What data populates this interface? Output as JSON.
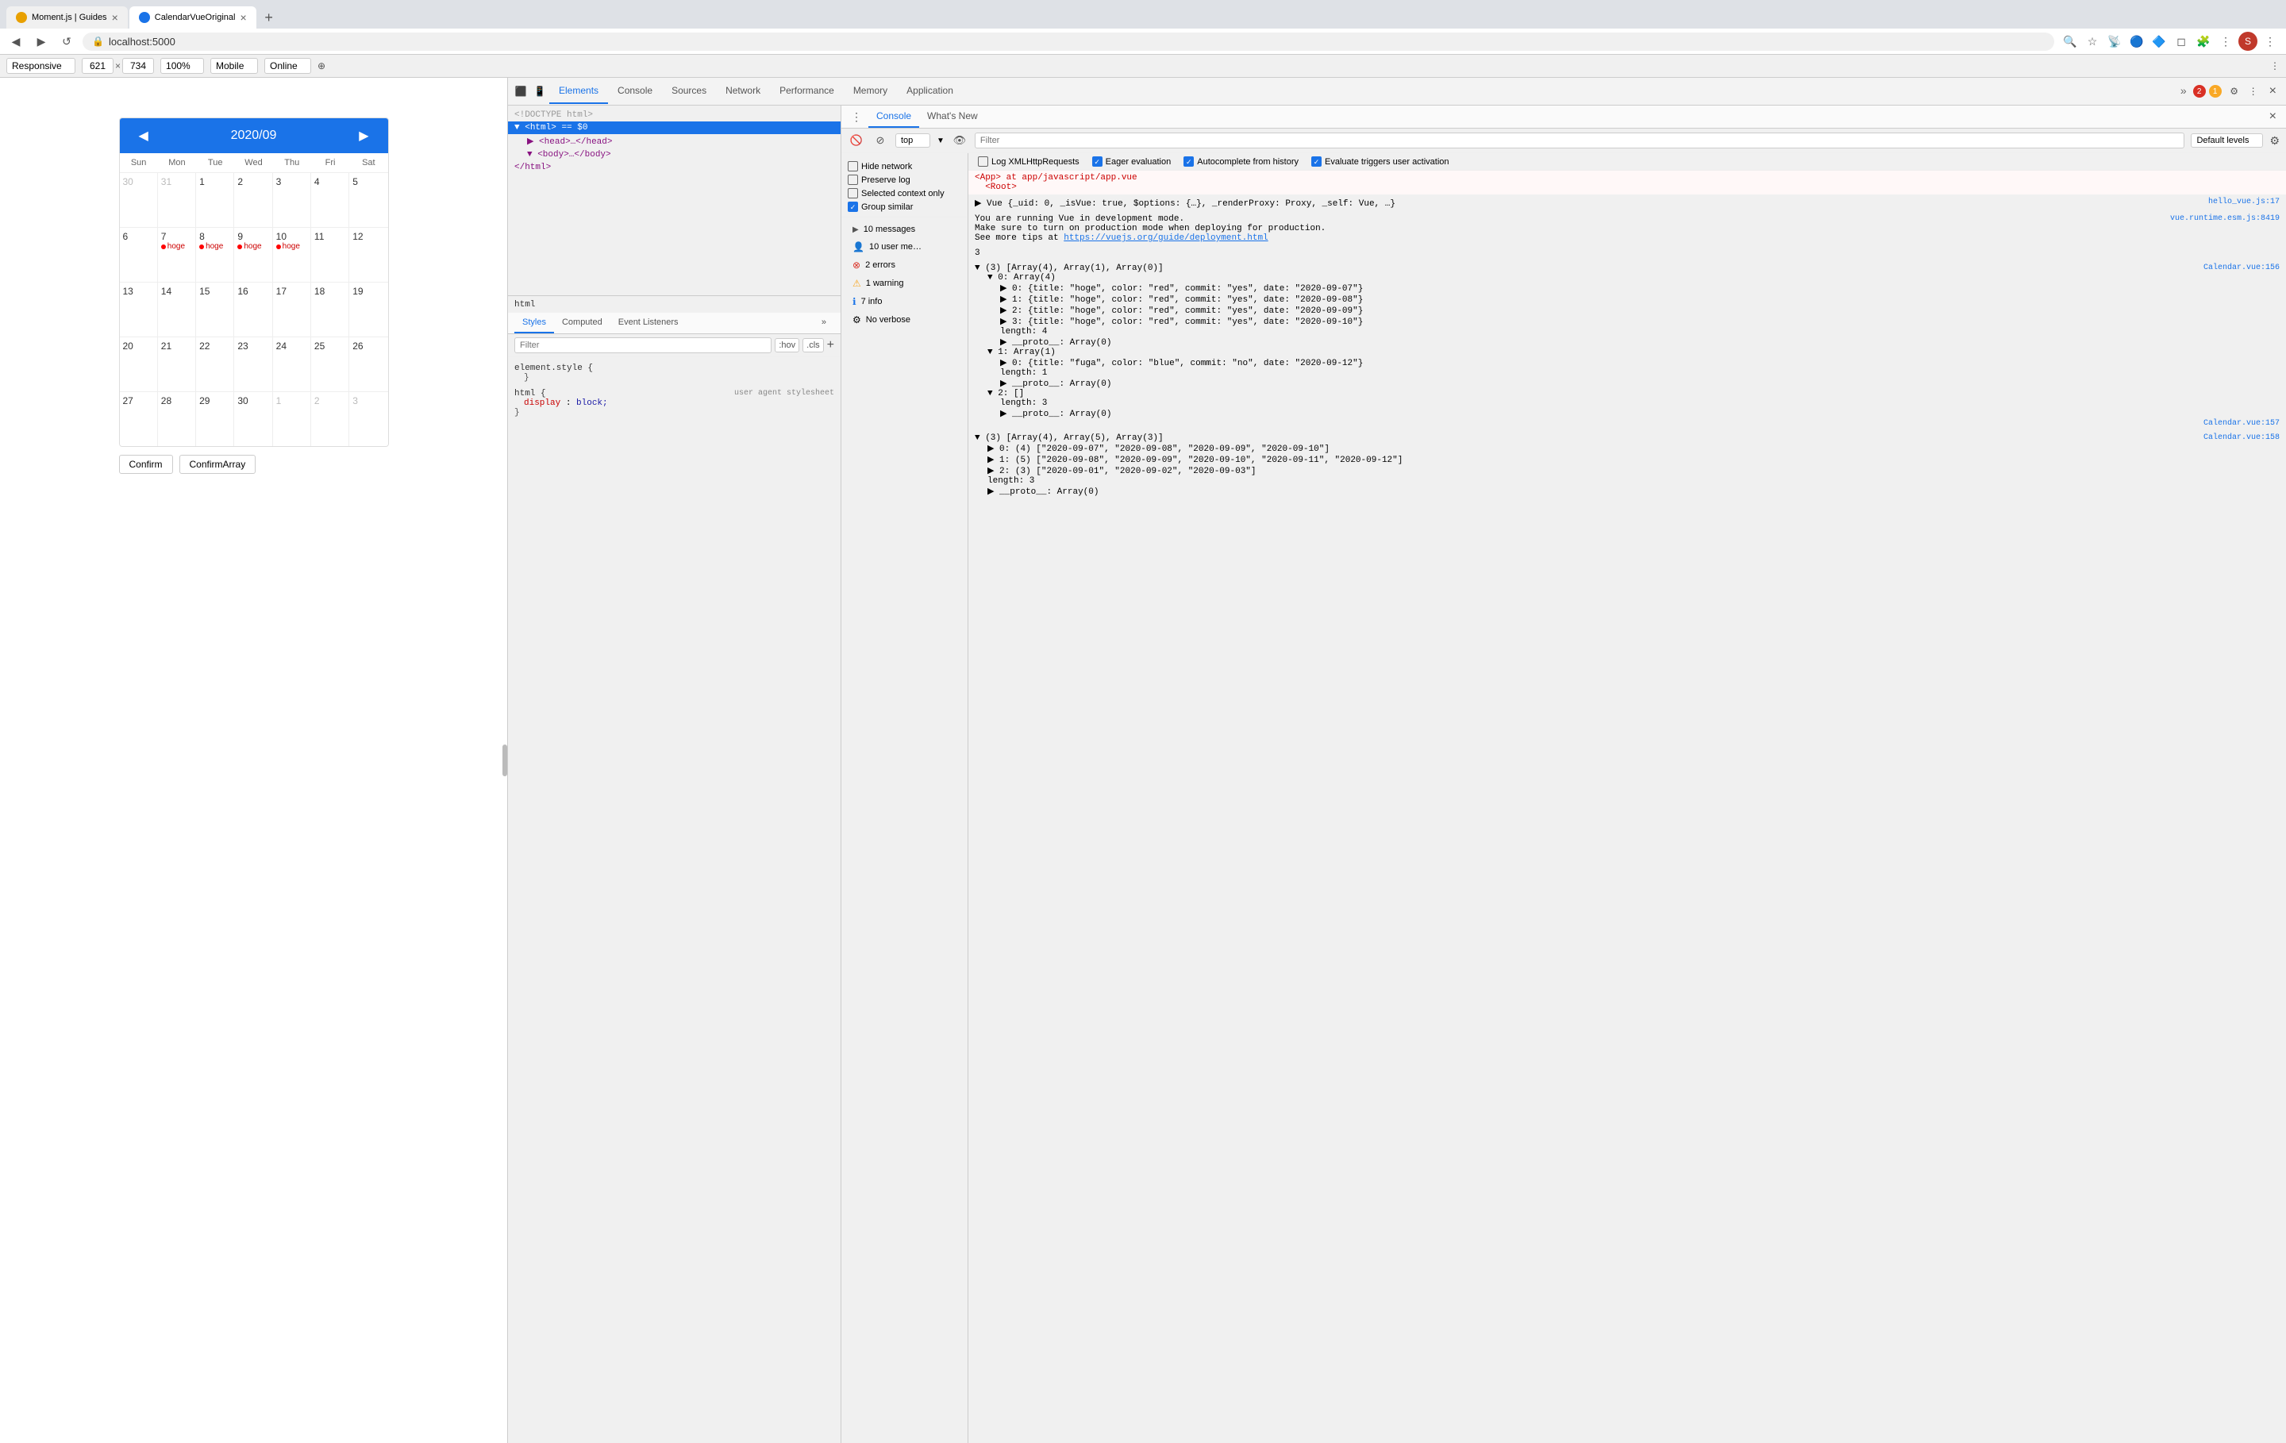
{
  "browser": {
    "tabs": [
      {
        "id": "tab1",
        "title": "Moment.js | Guides",
        "favicon_color": "#e8a000",
        "active": false
      },
      {
        "id": "tab2",
        "title": "CalendarVueOriginal",
        "favicon_color": "#1a73e8",
        "active": true
      }
    ],
    "new_tab_label": "+",
    "url": "localhost:5000",
    "nav": {
      "back_label": "◀",
      "forward_label": "▶",
      "reload_label": "↺"
    }
  },
  "devtools_bar": {
    "responsive_label": "Responsive",
    "width": "621",
    "height": "734",
    "zoom": "100%",
    "device": "Mobile",
    "throttle": "Online"
  },
  "devtools": {
    "tabs": [
      "Elements",
      "Console",
      "Sources",
      "Network",
      "Performance",
      "Memory",
      "Application"
    ],
    "active_tab": "Elements",
    "icons": [
      "device-toolbar",
      "inspect"
    ],
    "settings_label": "⚙",
    "close_label": "×",
    "more_label": "»"
  },
  "elements": {
    "lines": [
      {
        "text": "<!DOCTYPE html>",
        "indent": 0
      },
      {
        "text": "▼ <html> == $0",
        "indent": 0,
        "selected": true
      },
      {
        "text": "▶ <head>…</head>",
        "indent": 1
      },
      {
        "text": "▼ <body>…</body>",
        "indent": 1
      },
      {
        "text": "</html>",
        "indent": 0
      }
    ],
    "footer": "html"
  },
  "styles": {
    "sub_tabs": [
      "Styles",
      "Computed",
      "Event Listeners"
    ],
    "active_sub_tab": "Styles",
    "filter_placeholder": "Filter",
    "hov_label": ":hov",
    "cls_label": ".cls",
    "plus_label": "+",
    "rules": [
      {
        "selector": "element.style {",
        "props": [],
        "closing": "}",
        "source": ""
      },
      {
        "selector": "html {",
        "props": [
          {
            "name": "display",
            "value": "block;"
          }
        ],
        "closing": "}",
        "source": "user agent stylesheet"
      }
    ]
  },
  "console": {
    "tabs": [
      "Console",
      "What's New"
    ],
    "active_tab": "Console",
    "toolbar": {
      "ban_label": "🚫",
      "top_value": "top",
      "eye_label": "👁",
      "filter_placeholder": "Filter",
      "default_levels": "Default levels",
      "gear_label": "⚙"
    },
    "sidebar_items": [
      {
        "icon": "▶",
        "label": "10 messages",
        "count": "10",
        "active": false
      },
      {
        "icon": "👤",
        "label": "10 user me…",
        "count": "10",
        "active": false
      },
      {
        "icon": "🔴",
        "label": "2 errors",
        "count": "2",
        "active": false
      },
      {
        "icon": "⚠",
        "label": "1 warning",
        "count": "1",
        "active": false
      },
      {
        "icon": "ℹ",
        "label": "7 info",
        "count": "7",
        "active": false
      },
      {
        "icon": "⚙",
        "label": "No verbose",
        "count": "",
        "active": false
      }
    ],
    "checkboxes_left": [
      {
        "label": "Hide network",
        "checked": false
      },
      {
        "label": "Preserve log",
        "checked": false
      },
      {
        "label": "Selected context only",
        "checked": false
      },
      {
        "label": "Group similar",
        "checked": true
      }
    ],
    "checkboxes_right": [
      {
        "label": "Log XMLHttpRequests",
        "checked": false
      },
      {
        "label": "Eager evaluation",
        "checked": true
      },
      {
        "label": "Autocomplete from history",
        "checked": true
      },
      {
        "label": "Evaluate triggers user activation",
        "checked": false
      }
    ],
    "messages": [
      {
        "type": "info",
        "text": "<App> at app/javascript/app.vue\n  <Root>",
        "source": ""
      },
      {
        "type": "object",
        "text": "▶ Vue {_uid: 0, _isVue: true, $options: {…}, _renderProxy: Proxy, _self: Vue, …}",
        "source": "hello_vue.js:17"
      },
      {
        "type": "info",
        "text": "You are running Vue in development mode.\nMake sure to turn on production mode when deploying for production.\nSee more tips at https://vuejs.org/guide/deployment.html",
        "source": "vue.runtime.esm.js:8419"
      },
      {
        "type": "num",
        "text": "3",
        "source": ""
      },
      {
        "type": "array_expanded",
        "text": "",
        "source": "Calendar.vue:156",
        "source2": "Calendar.vue:157"
      }
    ],
    "array_data": {
      "header": "▼ (3) [Array(4), Array(1), Array(0)]",
      "arr0": {
        "label": "▼ 0: Array(4)",
        "items": [
          "▶ 0: {title: \"hoge\", color: \"red\", commit: \"yes\", date: \"2020-09-07\"}",
          "▶ 1: {title: \"hoge\", color: \"red\", commit: \"yes\", date: \"2020-09-08\"}",
          "▶ 2: {title: \"hoge\", color: \"red\", commit: \"yes\", date: \"2020-09-09\"}",
          "▶ 3: {title: \"hoge\", color: \"red\", commit: \"yes\", date: \"2020-09-10\"}"
        ],
        "length": "length: 4",
        "proto": "▶ __proto__: Array(0)"
      },
      "arr1": {
        "label": "▼ 1: Array(1)",
        "items": [
          "▶ 0: {title: \"fuga\", color: \"blue\", commit: \"no\", date: \"2020-09-12\"}"
        ],
        "length": "length: 1",
        "proto": "▶ __proto__: Array(0)"
      },
      "arr2": {
        "label": "▼ 2: []",
        "length": "length: 3",
        "proto": "▶ __proto__: Array(0)"
      },
      "outer_length": "length: 3",
      "outer_proto": "▶ __proto__: Array(0)"
    },
    "array_data2": {
      "header": "▼ (3) [Array(4), Array(5), Array(3)]",
      "source": "Calendar.vue:158",
      "arr0": "▶ 0: (4) [\"2020-09-07\", \"2020-09-08\", \"2020-09-09\", \"2020-09-10\"]",
      "arr1": "▶ 1: (5) [\"2020-09-08\", \"2020-09-09\", \"2020-09-10\", \"2020-09-11\", \"2020-09-12\"]",
      "arr2": "▶ 2: (3) [\"2020-09-01\", \"2020-09-02\", \"2020-09-03\"]",
      "length": "length: 3",
      "proto": "▶ __proto__: Array(0)"
    }
  },
  "calendar": {
    "title": "2020/09",
    "prev_label": "◀",
    "next_label": "▶",
    "day_names": [
      "Sun",
      "Mon",
      "Tue",
      "Wed",
      "Thu",
      "Fri",
      "Sat"
    ],
    "weeks": [
      [
        {
          "num": "30",
          "other": true,
          "events": []
        },
        {
          "num": "31",
          "other": true,
          "events": []
        },
        {
          "num": "1",
          "other": false,
          "events": []
        },
        {
          "num": "2",
          "other": false,
          "events": []
        },
        {
          "num": "3",
          "other": false,
          "events": []
        },
        {
          "num": "4",
          "other": false,
          "events": []
        },
        {
          "num": "5",
          "other": false,
          "events": []
        }
      ],
      [
        {
          "num": "6",
          "other": false,
          "events": []
        },
        {
          "num": "7",
          "other": false,
          "events": [
            {
              "color": "red",
              "text": "hoge"
            }
          ]
        },
        {
          "num": "8",
          "other": false,
          "events": [
            {
              "color": "red",
              "text": "hoge"
            }
          ]
        },
        {
          "num": "9",
          "other": false,
          "events": [
            {
              "color": "red",
              "text": "hoge"
            }
          ]
        },
        {
          "num": "10",
          "other": false,
          "events": [
            {
              "color": "red",
              "text": "hoge"
            }
          ]
        },
        {
          "num": "11",
          "other": false,
          "events": []
        },
        {
          "num": "12",
          "other": false,
          "events": []
        }
      ],
      [
        {
          "num": "13",
          "other": false,
          "events": []
        },
        {
          "num": "14",
          "other": false,
          "events": []
        },
        {
          "num": "15",
          "other": false,
          "events": []
        },
        {
          "num": "16",
          "other": false,
          "events": []
        },
        {
          "num": "17",
          "other": false,
          "events": []
        },
        {
          "num": "18",
          "other": false,
          "events": []
        },
        {
          "num": "19",
          "other": false,
          "events": []
        }
      ],
      [
        {
          "num": "20",
          "other": false,
          "events": []
        },
        {
          "num": "21",
          "other": false,
          "events": []
        },
        {
          "num": "22",
          "other": false,
          "events": []
        },
        {
          "num": "23",
          "other": false,
          "events": []
        },
        {
          "num": "24",
          "other": false,
          "events": []
        },
        {
          "num": "25",
          "other": false,
          "events": []
        },
        {
          "num": "26",
          "other": false,
          "events": []
        }
      ],
      [
        {
          "num": "27",
          "other": false,
          "events": []
        },
        {
          "num": "28",
          "other": false,
          "events": []
        },
        {
          "num": "29",
          "other": false,
          "events": []
        },
        {
          "num": "30",
          "other": false,
          "events": []
        },
        {
          "num": "1",
          "other": true,
          "events": []
        },
        {
          "num": "2",
          "other": true,
          "events": []
        },
        {
          "num": "3",
          "other": true,
          "events": []
        }
      ]
    ],
    "confirm_label": "Confirm",
    "confirm_array_label": "ConfirmArray"
  }
}
